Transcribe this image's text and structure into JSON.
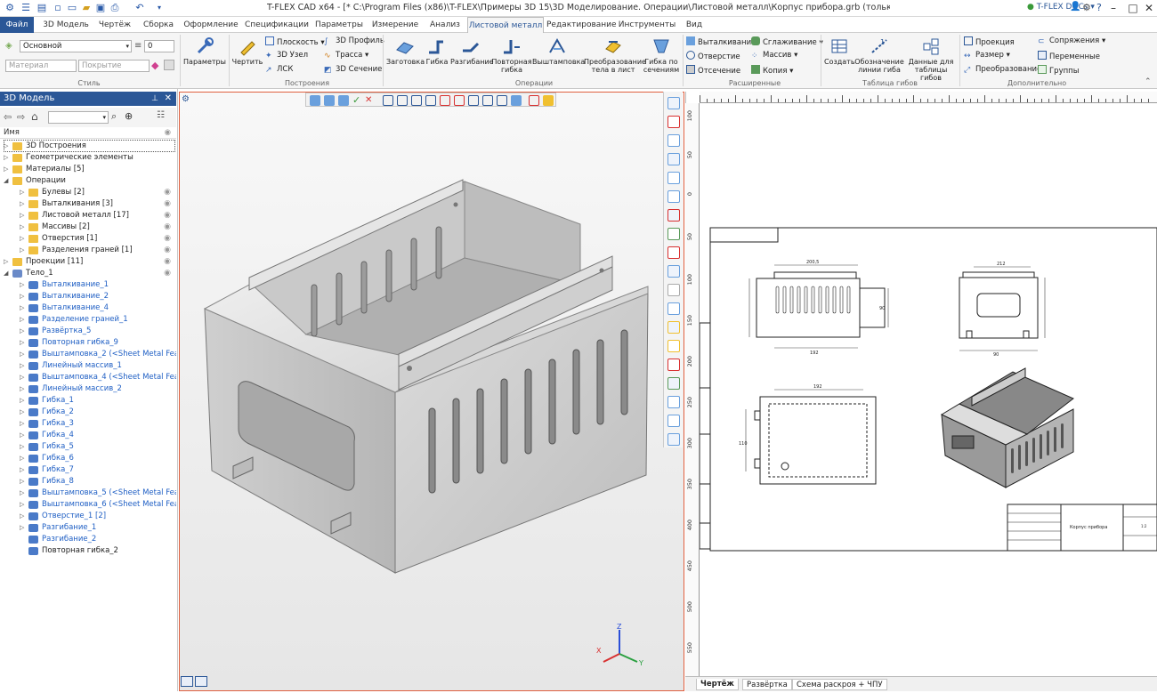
{
  "app": {
    "title": "T-FLEX CAD x64 - [* C:\\Program Files (x86)\\T-FLEX\\Примеры 3D 15\\3D Моделирование. Операции\\Листовой металл\\Корпус прибора.grb (только чтение)]",
    "docs_label": "T-FLEX DOCs"
  },
  "menu": {
    "tabs": [
      "Файл",
      "3D Модель",
      "Чертёж",
      "Сборка",
      "Оформление",
      "Спецификации",
      "Параметры",
      "Измерение",
      "Анализ",
      "Листовой металл",
      "Редактирование",
      "Инструменты",
      "Вид"
    ],
    "active": "Листовой металл"
  },
  "ribbon": {
    "style": {
      "layer": "Основной",
      "layer_num": "0",
      "material_placeholder": "Материал",
      "coating_placeholder": "Покрытие",
      "label": "Стиль"
    },
    "params_label": "Параметры",
    "draw_label": "Чертить",
    "constructions": {
      "plane": "Плоскость",
      "node3d": "3D Узел",
      "lsk": "ЛСК",
      "profile3d": "3D Профиль",
      "path": "Трасса",
      "section3d": "3D Сечение",
      "label": "Построения"
    },
    "operations": {
      "blank": "Заготовка",
      "bend": "Гибка",
      "unbend": "Разгибание",
      "rebend": "Повторная гибка",
      "stamp": "Выштамповка",
      "transform": "Преобразование тела в лист",
      "bend_sections": "Гибка по сечениям",
      "label": "Операции"
    },
    "extended": {
      "extrude": "Выталкивание",
      "hole": "Отверстие",
      "cut": "Отсечение",
      "smooth": "Сглаживание",
      "array": "Массив",
      "copy": "Копия",
      "label": "Расширенные"
    },
    "bend_table": {
      "create": "Создать",
      "designation": "Обозначение линии гиба",
      "data": "Данные для таблицы гибов",
      "label": "Таблица гибов"
    },
    "additional": {
      "projection": "Проекция",
      "size": "Размер",
      "transform": "Преобразование",
      "pairing": "Сопряжения",
      "variables": "Переменные",
      "groups": "Группы",
      "label": "Дополнительно"
    }
  },
  "model_panel": {
    "title": "3D Модель",
    "column": "Имя",
    "items": [
      {
        "label": "3D Построения",
        "indent": 0,
        "exp": "▷",
        "icon": "folder-icon",
        "color": "#222",
        "eye": false
      },
      {
        "label": "Геометрические элементы",
        "indent": 0,
        "exp": "▷",
        "icon": "folder-icon",
        "color": "#222",
        "eye": false
      },
      {
        "label": "Материалы [5]",
        "indent": 0,
        "exp": "▷",
        "icon": "folder-icon",
        "color": "#222",
        "eye": false
      },
      {
        "label": "Операции",
        "indent": 0,
        "exp": "◢",
        "icon": "folder-open-icon",
        "color": "#222",
        "eye": false
      },
      {
        "label": "Булевы [2]",
        "indent": 1,
        "exp": "▷",
        "icon": "folder-icon",
        "color": "#222",
        "eye": true
      },
      {
        "label": "Выталкивания [3]",
        "indent": 1,
        "exp": "▷",
        "icon": "folder-icon",
        "color": "#222",
        "eye": true
      },
      {
        "label": "Листовой металл [17]",
        "indent": 1,
        "exp": "▷",
        "icon": "folder-icon",
        "color": "#222",
        "eye": true
      },
      {
        "label": "Массивы [2]",
        "indent": 1,
        "exp": "▷",
        "icon": "folder-icon",
        "color": "#222",
        "eye": true
      },
      {
        "label": "Отверстия [1]",
        "indent": 1,
        "exp": "▷",
        "icon": "folder-icon",
        "color": "#222",
        "eye": true
      },
      {
        "label": "Разделения граней [1]",
        "indent": 1,
        "exp": "▷",
        "icon": "folder-icon",
        "color": "#222",
        "eye": true
      },
      {
        "label": "Проекции [11]",
        "indent": 0,
        "exp": "▷",
        "icon": "folder-icon",
        "color": "#222",
        "eye": true
      },
      {
        "label": "Тело_1",
        "indent": 0,
        "exp": "◢",
        "icon": "body-icon",
        "color": "#222",
        "eye": true
      },
      {
        "label": "Выталкивание_1",
        "indent": 1,
        "exp": "▷",
        "icon": "extrude-icon",
        "color": "#1f5fc4",
        "eye": false
      },
      {
        "label": "Выталкивание_2",
        "indent": 1,
        "exp": "▷",
        "icon": "extrude-icon",
        "color": "#1f5fc4",
        "eye": false
      },
      {
        "label": "Выталкивание_4",
        "indent": 1,
        "exp": "▷",
        "icon": "extrude-icon",
        "color": "#1f5fc4",
        "eye": false
      },
      {
        "label": "Разделение граней_1",
        "indent": 1,
        "exp": "▷",
        "icon": "split-faces-icon",
        "color": "#1f5fc4",
        "eye": false
      },
      {
        "label": "Развёртка_5",
        "indent": 1,
        "exp": "▷",
        "icon": "unfold-icon",
        "color": "#1f5fc4",
        "eye": false
      },
      {
        "label": "Повторная гибка_9",
        "indent": 1,
        "exp": "▷",
        "icon": "rebend-icon",
        "color": "#1f5fc4",
        "eye": false
      },
      {
        "label": "Выштамповка_2 (<Sheet Metal Fea...",
        "indent": 1,
        "exp": "▷",
        "icon": "stamp-icon",
        "color": "#1f5fc4",
        "eye": false
      },
      {
        "label": "Линейный массив_1",
        "indent": 1,
        "exp": "▷",
        "icon": "array-icon",
        "color": "#1f5fc4",
        "eye": false
      },
      {
        "label": "Выштамповка_4 (<Sheet Metal Fea...",
        "indent": 1,
        "exp": "▷",
        "icon": "stamp-icon",
        "color": "#1f5fc4",
        "eye": false
      },
      {
        "label": "Линейный массив_2",
        "indent": 1,
        "exp": "▷",
        "icon": "array-icon",
        "color": "#1f5fc4",
        "eye": false
      },
      {
        "label": "Гибка_1",
        "indent": 1,
        "exp": "▷",
        "icon": "bend-icon",
        "color": "#1f5fc4",
        "eye": false
      },
      {
        "label": "Гибка_2",
        "indent": 1,
        "exp": "▷",
        "icon": "bend-icon",
        "color": "#1f5fc4",
        "eye": false
      },
      {
        "label": "Гибка_3",
        "indent": 1,
        "exp": "▷",
        "icon": "bend-icon",
        "color": "#1f5fc4",
        "eye": false
      },
      {
        "label": "Гибка_4",
        "indent": 1,
        "exp": "▷",
        "icon": "bend-icon",
        "color": "#1f5fc4",
        "eye": false
      },
      {
        "label": "Гибка_5",
        "indent": 1,
        "exp": "▷",
        "icon": "bend-icon",
        "color": "#1f5fc4",
        "eye": false
      },
      {
        "label": "Гибка_6",
        "indent": 1,
        "exp": "▷",
        "icon": "bend-icon",
        "color": "#1f5fc4",
        "eye": false
      },
      {
        "label": "Гибка_7",
        "indent": 1,
        "exp": "▷",
        "icon": "bend-icon",
        "color": "#1f5fc4",
        "eye": false
      },
      {
        "label": "Гибка_8",
        "indent": 1,
        "exp": "▷",
        "icon": "bend-icon",
        "color": "#1f5fc4",
        "eye": false
      },
      {
        "label": "Выштамповка_5 (<Sheet Metal Fea...",
        "indent": 1,
        "exp": "▷",
        "icon": "stamp-icon",
        "color": "#1f5fc4",
        "eye": false
      },
      {
        "label": "Выштамповка_6 (<Sheet Metal Fea...",
        "indent": 1,
        "exp": "▷",
        "icon": "stamp-icon",
        "color": "#1f5fc4",
        "eye": false
      },
      {
        "label": "Отверстие_1 [2]",
        "indent": 1,
        "exp": "▷",
        "icon": "hole-icon",
        "color": "#1f5fc4",
        "eye": false
      },
      {
        "label": "Разгибание_1",
        "indent": 1,
        "exp": "▷",
        "icon": "unbend-icon",
        "color": "#1f5fc4",
        "eye": false
      },
      {
        "label": "Разгибание_2",
        "indent": 1,
        "exp": "",
        "icon": "unbend-icon",
        "color": "#1f5fc4",
        "eye": false
      },
      {
        "label": "Повторная гибка_2",
        "indent": 1,
        "exp": "",
        "icon": "rebend-icon",
        "color": "#222",
        "eye": false
      }
    ]
  },
  "drawing": {
    "dims": {
      "d1": "200,5",
      "d2": "212",
      "d3": "90",
      "d4": "192",
      "d5": "110"
    },
    "title_block": {
      "name": "Корпус прибора",
      "scale": "1:2"
    }
  },
  "ruler": {
    "left": [
      "100",
      "50",
      "0",
      "50",
      "100",
      "150",
      "200",
      "250",
      "300",
      "350",
      "400",
      "450",
      "500",
      "550"
    ]
  },
  "sheet_tabs": [
    "Чертёж",
    "Развёртка",
    "Схема раскроя + ЧПУ"
  ],
  "axes": {
    "x": "X",
    "y": "Y",
    "z": "Z"
  },
  "colors": {
    "accent": "#2b5797",
    "viewport_border": "#e06040",
    "link": "#1f5fc4"
  }
}
